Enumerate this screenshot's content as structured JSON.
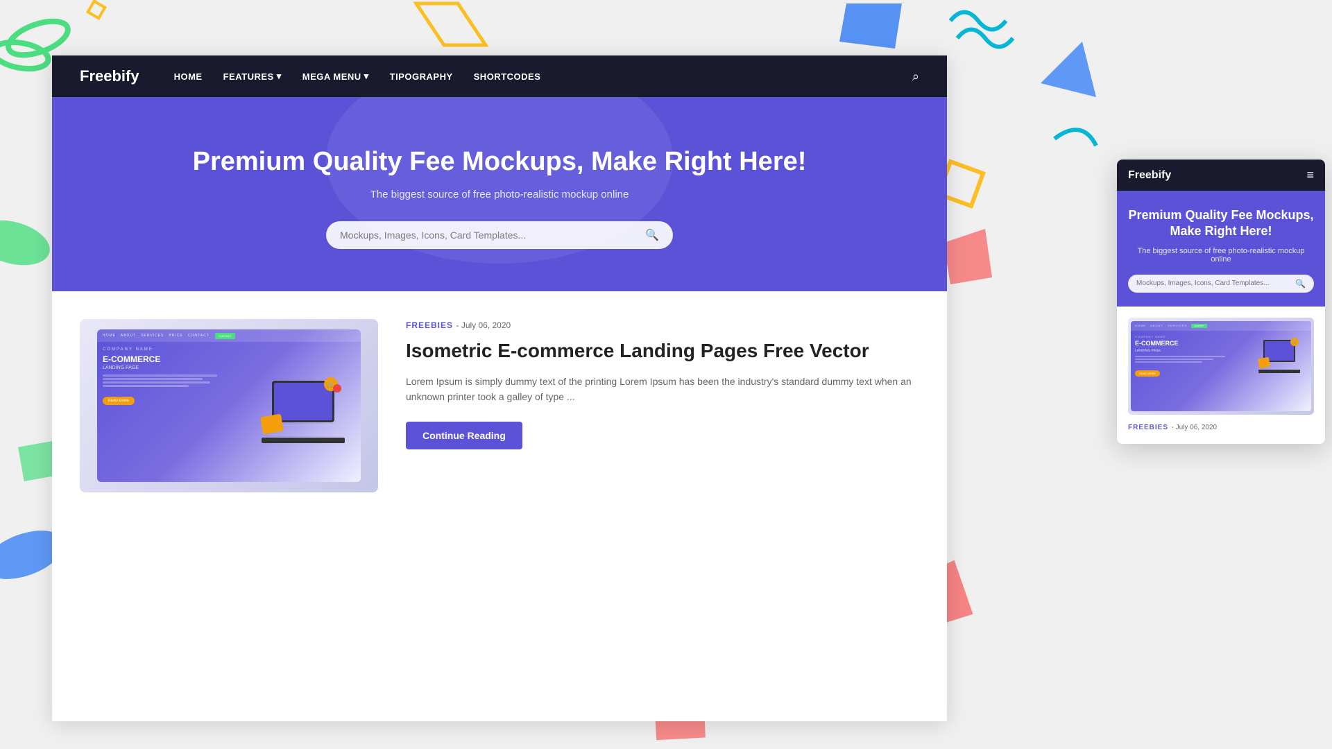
{
  "background": {
    "color": "#f0f0f0"
  },
  "navbar": {
    "logo": "Freebify",
    "items": [
      {
        "label": "HOME",
        "hasDropdown": false
      },
      {
        "label": "FEATURES",
        "hasDropdown": true
      },
      {
        "label": "MEGA MENU",
        "hasDropdown": true
      },
      {
        "label": "TIPOGRAPHY",
        "hasDropdown": false
      },
      {
        "label": "SHORTCODES",
        "hasDropdown": false
      }
    ]
  },
  "hero": {
    "title": "Premium Quality Fee Mockups, Make Right Here!",
    "subtitle": "The biggest source of free photo-realistic mockup online",
    "search_placeholder": "Mockups, Images, Icons, Card Templates..."
  },
  "blog": {
    "category": "FREEBIES",
    "date": "July 06, 2020",
    "title": "Isometric E-commerce Landing Pages Free Vector",
    "excerpt": "Lorem Ipsum is simply dummy text of the printing Lorem Ipsum has been the industry's standard dummy text when an unknown printer took a galley of type ...",
    "continue_label": "Continue Reading",
    "ecom_mockup": {
      "company": "COMPANY NAME",
      "title": "E-COMMERCE",
      "subtitle": "LANDING PAGE",
      "btn": "READ MORE",
      "nav_btn": "CONTACT"
    }
  },
  "mobile_panel": {
    "logo": "Freebify",
    "hero_title": "Premium Quality Fee Mockups, Make Right Here!",
    "hero_subtitle": "The biggest source of free photo-realistic mockup online",
    "search_placeholder": "Mockups, Images, Icons, Card Templates...",
    "post_category": "FREEBIES",
    "post_date": "July 06, 2020",
    "ecom_mockup": {
      "company": "COMPANY NAME",
      "title": "E-COMMERCE",
      "subtitle": "LANDING PAGE",
      "btn": "READ MORE"
    }
  }
}
